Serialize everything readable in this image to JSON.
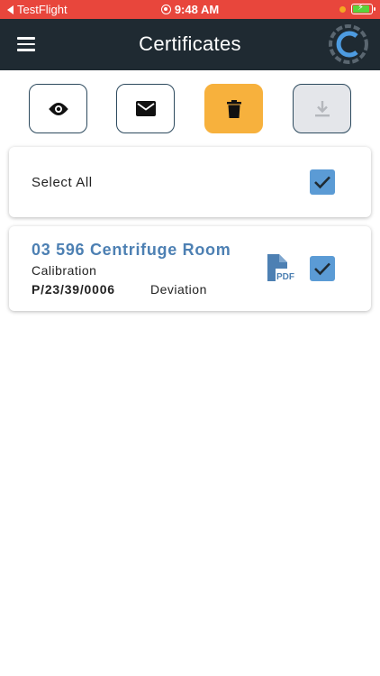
{
  "status_bar": {
    "back_app": "TestFlight",
    "time": "9:48 AM"
  },
  "header": {
    "title": "Certificates",
    "menu_icon": "hamburger-menu-icon",
    "logo": "company-logo"
  },
  "toolbar": [
    {
      "action": "view",
      "icon": "eye-icon"
    },
    {
      "action": "email",
      "icon": "envelope-icon"
    },
    {
      "action": "delete",
      "icon": "trash-icon",
      "highlighted": true
    },
    {
      "action": "download",
      "icon": "download-icon",
      "disabled": true
    }
  ],
  "select_all": {
    "label": "Select All",
    "checked": true
  },
  "certificates": [
    {
      "title": "03 596 Centrifuge Room",
      "type": "Calibration",
      "number": "P/23/39/0006",
      "status": "Deviation",
      "file_icon": "pdf-file-icon",
      "checked": true
    }
  ],
  "colors": {
    "status_bar": "#e8463c",
    "header": "#1f2a32",
    "accent_blue": "#4d80b3",
    "checkbox": "#5b9bd5",
    "delete_button": "#f7b13d"
  }
}
